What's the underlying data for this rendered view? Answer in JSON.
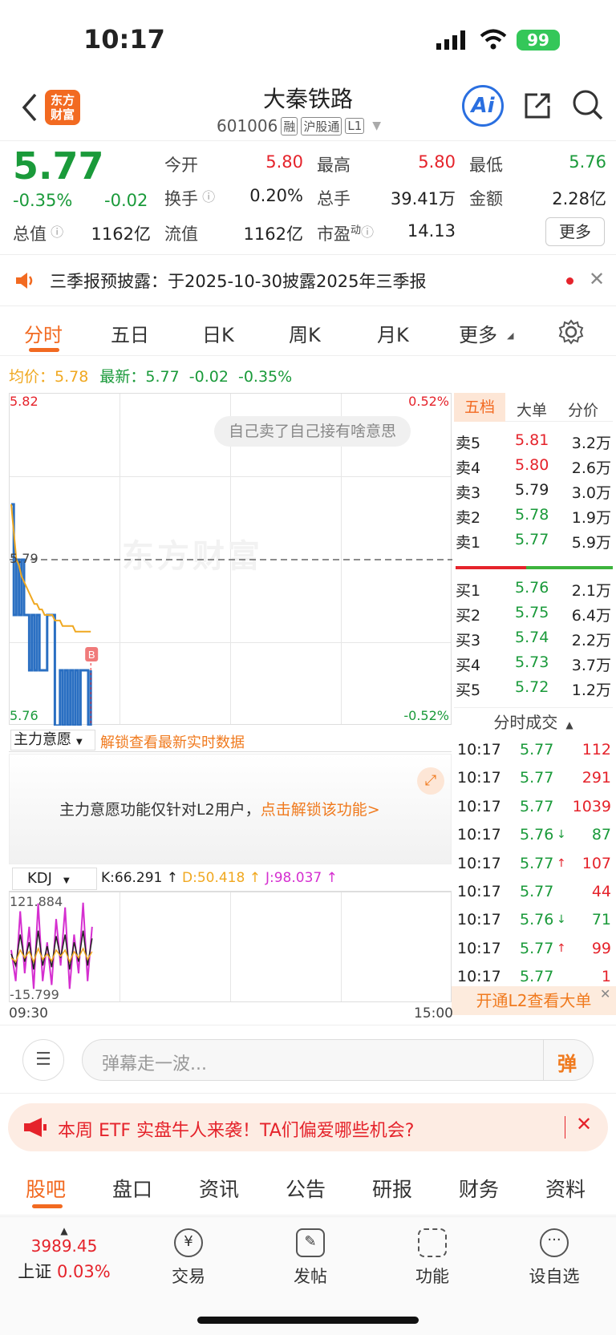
{
  "status_bar": {
    "time": "10:17",
    "battery": "99"
  },
  "header": {
    "logo": "东方财富",
    "stock_name": "大秦铁路",
    "stock_code": "601006",
    "badges": [
      "融",
      "沪股通",
      "L1"
    ],
    "ai_label": "Ai"
  },
  "quote": {
    "price": "5.77",
    "change_pct": "-0.35%",
    "change": "-0.02",
    "total_value_label": "总值",
    "total_value": "1162亿",
    "float_value_label": "流值",
    "float_value": "1162亿",
    "pe_label": "市盈",
    "pe_sup": "动",
    "pe": "14.13",
    "open_label": "今开",
    "open": "5.80",
    "high_label": "最高",
    "high": "5.80",
    "low_label": "最低",
    "low": "5.76",
    "turnover_label": "换手",
    "turnover": "0.20%",
    "volume_label": "总手",
    "volume": "39.41万",
    "amount_label": "金额",
    "amount": "2.28亿",
    "more_label": "更多"
  },
  "notice": {
    "text": "三季报预披露：于2025-10-30披露2025年三季报"
  },
  "tabs": [
    "分时",
    "五日",
    "日K",
    "周K",
    "月K",
    "更多"
  ],
  "active_tab": "分时",
  "chart_info": {
    "avg_label": "均价：",
    "avg": "5.78",
    "latest_label": "最新：",
    "latest": "5.77",
    "change": "-0.02",
    "change_pct": "-0.35%"
  },
  "chart_data": {
    "type": "line",
    "title": "",
    "y_top": "5.82",
    "y_mid": "5.79",
    "y_bottom": "5.76",
    "pct_top": "0.52%",
    "pct_bottom": "-0.52%",
    "ylim": [
      5.76,
      5.82
    ],
    "prev_close": 5.79,
    "series": [
      {
        "name": "",
        "color": "#2a6fc2",
        "values": [
          5.8,
          5.78,
          5.79,
          5.78,
          5.79,
          5.78,
          5.78,
          5.77,
          5.78,
          5.77,
          5.78,
          5.77,
          5.77,
          5.77,
          5.78,
          5.78,
          5.78,
          5.76,
          5.76,
          5.77,
          5.76,
          5.77,
          5.76,
          5.77,
          5.76,
          5.77,
          5.76,
          5.77,
          5.77,
          5.77,
          5.76,
          5.77
        ]
      },
      {
        "name": "",
        "color": "#f0a820",
        "values": [
          5.8,
          5.795,
          5.79,
          5.789,
          5.787,
          5.786,
          5.785,
          5.784,
          5.783,
          5.782,
          5.782,
          5.781,
          5.781,
          5.78,
          5.78,
          5.78,
          5.78,
          5.779,
          5.779,
          5.779,
          5.778,
          5.778,
          5.778,
          5.778,
          5.778,
          5.777,
          5.777,
          5.777,
          5.777,
          5.777,
          5.777,
          5.777
        ]
      }
    ],
    "watermark": "东方财富",
    "danmaku": "自己卖了自己接有啥意思",
    "marker": "B",
    "x_start": "09:30",
    "x_end": "15:00"
  },
  "orderbook": {
    "tabs": [
      "五档",
      "大单",
      "分价"
    ],
    "asks": [
      {
        "label": "卖5",
        "price": "5.81",
        "vol": "3.2万",
        "color": "red"
      },
      {
        "label": "卖4",
        "price": "5.80",
        "vol": "2.6万",
        "color": "red"
      },
      {
        "label": "卖3",
        "price": "5.79",
        "vol": "3.0万",
        "color": "black"
      },
      {
        "label": "卖2",
        "price": "5.78",
        "vol": "1.9万",
        "color": "green"
      },
      {
        "label": "卖1",
        "price": "5.77",
        "vol": "5.9万",
        "color": "green"
      }
    ],
    "bids": [
      {
        "label": "买1",
        "price": "5.76",
        "vol": "2.1万",
        "color": "green"
      },
      {
        "label": "买2",
        "price": "5.75",
        "vol": "6.4万",
        "color": "green"
      },
      {
        "label": "买3",
        "price": "5.74",
        "vol": "2.2万",
        "color": "green"
      },
      {
        "label": "买4",
        "price": "5.73",
        "vol": "3.7万",
        "color": "green"
      },
      {
        "label": "买5",
        "price": "5.72",
        "vol": "1.2万",
        "color": "green"
      }
    ],
    "buy_ratio": 0.45
  },
  "trades": {
    "title": "分时成交",
    "rows": [
      {
        "time": "10:17",
        "price": "5.77",
        "vol": "112",
        "arrow": ""
      },
      {
        "time": "10:17",
        "price": "5.77",
        "vol": "291",
        "arrow": ""
      },
      {
        "time": "10:17",
        "price": "5.77",
        "vol": "1039",
        "arrow": ""
      },
      {
        "time": "10:17",
        "price": "5.76",
        "vol": "87",
        "arrow": "↓"
      },
      {
        "time": "10:17",
        "price": "5.77",
        "vol": "107",
        "arrow": "↑"
      },
      {
        "time": "10:17",
        "price": "5.77",
        "vol": "44",
        "arrow": ""
      },
      {
        "time": "10:17",
        "price": "5.76",
        "vol": "71",
        "arrow": "↓"
      },
      {
        "time": "10:17",
        "price": "5.77",
        "vol": "99",
        "arrow": "↑"
      },
      {
        "time": "10:17",
        "price": "5.77",
        "vol": "1",
        "arrow": ""
      }
    ],
    "l2_banner": "开通L2查看大单"
  },
  "main_force": {
    "select": "主力意愿",
    "unlock": "解锁查看最新实时数据",
    "msg": "主力意愿功能仅针对L2用户，",
    "msg_link": "点击解锁该功能>"
  },
  "kdj": {
    "select": "KDJ",
    "k": "K:66.291 ↑",
    "d": "D:50.418 ↑",
    "j": "J:98.037 ↑",
    "y_top": "121.884",
    "y_bottom": "-15.799"
  },
  "comment": {
    "placeholder": "弹幕走一波...",
    "danmaku_btn": "弹"
  },
  "ad": {
    "text": "本周 ETF 实盘牛人来袭！TA们偏爱哪些机会?"
  },
  "bottom_tabs": [
    "股吧",
    "盘口",
    "资讯",
    "公告",
    "研报",
    "财务",
    "资料"
  ],
  "nav": {
    "index_value": "3989.45",
    "index_name": "上证",
    "index_pct": "0.03%",
    "items": [
      "交易",
      "发帖",
      "功能",
      "设自选"
    ]
  }
}
